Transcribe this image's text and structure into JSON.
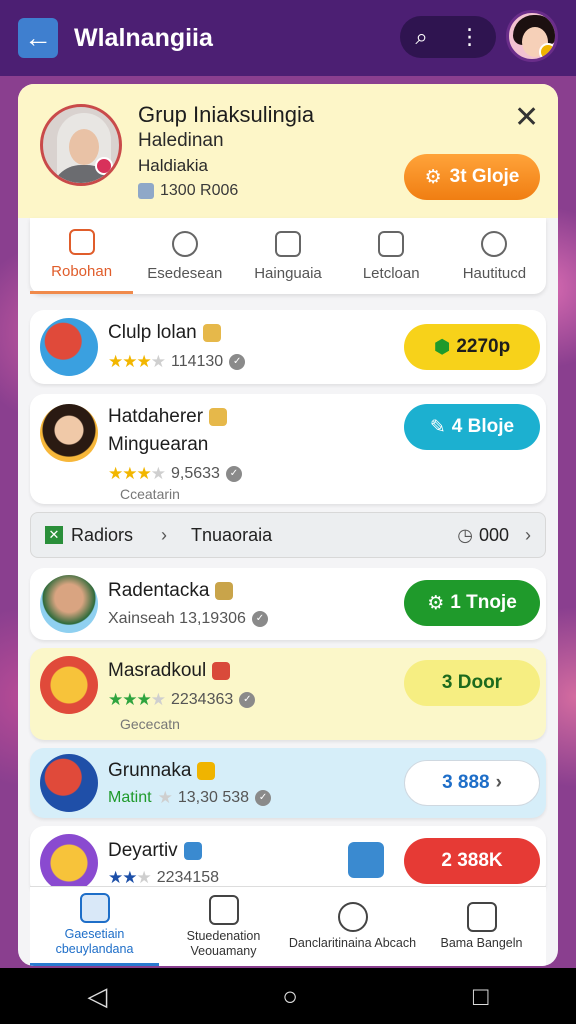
{
  "appbar": {
    "title": "Wlalnangiia",
    "search_icon": "⌕",
    "more_icon": "⋮"
  },
  "group": {
    "title": "Grup Iniaksulingia",
    "subtitle": "Haledinan",
    "subtitle2": "Haldiakia",
    "members": "1300 R006",
    "join_label": "3t Gloje",
    "close_icon": "✕"
  },
  "tabs": [
    {
      "label": "Robohan",
      "active": true
    },
    {
      "label": "Esedesean",
      "active": false
    },
    {
      "label": "Hainguaia",
      "active": false
    },
    {
      "label": "Letcloan",
      "active": false
    },
    {
      "label": "Hautitucd",
      "active": false
    }
  ],
  "items": [
    {
      "name": "Clulp lolan",
      "rating_text": "114130",
      "button": "2270p",
      "button_color": "#f7d21a",
      "button_text_color": "#1d1d1d"
    },
    {
      "name": "Hatdaherer",
      "name2": "Minguearan",
      "rating_text": "9,5633",
      "extra": "Cceatarin",
      "button": "4 Bloje",
      "button_color": "#1cb0d0",
      "button_text_color": "#ffffff"
    },
    {
      "name": "Radentacka",
      "meta_text": "Xainseah 13,19306",
      "button": "1 Tnoje",
      "button_color": "#1f9a2b",
      "button_text_color": "#ffffff"
    },
    {
      "name": "Masradkoul",
      "rating_text": "2234363",
      "extra": "Gececatn",
      "button": "3 Door",
      "button_color": "#f6ee82",
      "button_text_color": "#1d6a1d"
    },
    {
      "name": "Grunnaka",
      "meta_text": "Matint",
      "rating_text": "13,30 538",
      "button": "3 888",
      "button_color": "#ffffff",
      "button_text_color": "#1e6ec8"
    },
    {
      "name": "Deyartiv",
      "rating_text": "2234158",
      "button": "2 388K",
      "button_color": "#e63a35",
      "button_text_color": "#ffffff"
    }
  ],
  "filter": {
    "left_label": "Radiors",
    "middle_label": "Tnuaoraia",
    "count": "000"
  },
  "bottom_nav": [
    {
      "label": "Gaesetiain cbeuylandana",
      "active": true
    },
    {
      "label": "Stuedenation Veouamany",
      "active": false
    },
    {
      "label": "Danclaritinaina Abcach",
      "active": false
    },
    {
      "label": "Bama Bangeln",
      "active": false
    }
  ],
  "colors": {
    "appbar": "#4c1f73",
    "accent": "#e05d2b",
    "header_bg": "#fdf6c8"
  }
}
